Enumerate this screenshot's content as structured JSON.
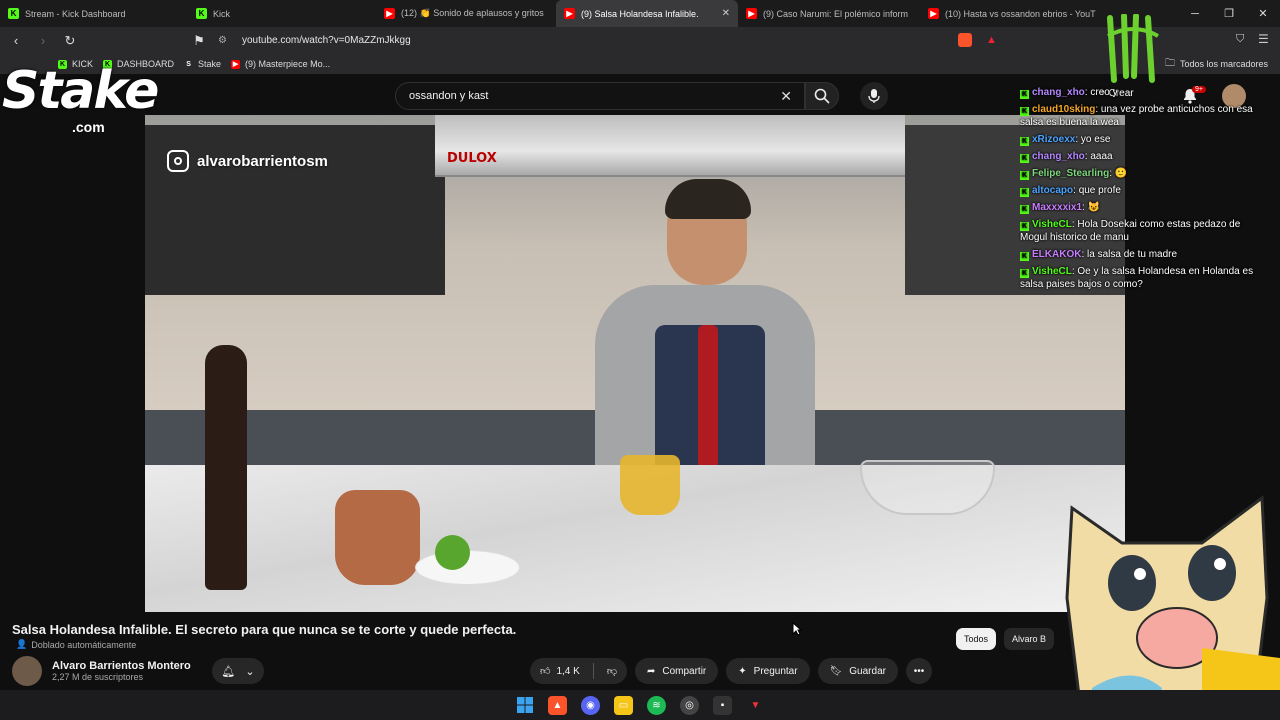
{
  "tabs": [
    {
      "label": "Stream - Kick Dashboard",
      "icon": "kick-icon",
      "active": false
    },
    {
      "label": "Kick",
      "icon": "kick-icon",
      "active": false
    },
    {
      "label": "(12) 👏 Sonido de aplausos y gritos",
      "icon": "youtube-icon",
      "active": false
    },
    {
      "label": "(9) Salsa Holandesa Infalible.",
      "icon": "youtube-icon",
      "active": true
    },
    {
      "label": "(9) Caso Narumi: El polémico inform",
      "icon": "youtube-icon",
      "active": false
    },
    {
      "label": "(10) Hasta vs ossandon ebrios - YouT",
      "icon": "youtube-icon",
      "active": false
    }
  ],
  "address": {
    "url": "youtube.com/watch?v=0MaZZmJkkgg"
  },
  "bookmarks": [
    {
      "label": "KICK",
      "icon": "kick-icon"
    },
    {
      "label": "DASHBOARD",
      "icon": "kick-icon"
    },
    {
      "label": "Stake",
      "icon": "stake-icon"
    },
    {
      "label": "(9) Masterpiece Mo...",
      "icon": "youtube-icon"
    }
  ],
  "bookmarks_folder": "Todos los marcadores",
  "search": {
    "value": "ossandon y kast"
  },
  "header": {
    "create_label": "Crear",
    "notifications_badge": "9+"
  },
  "video": {
    "watermark": "alvarobarrientosm",
    "hood_brand": "DULOX"
  },
  "overlay": {
    "stake_word": "Stake",
    "stake_suffix": ".com"
  },
  "chat": [
    {
      "user": "chang_xho",
      "color": "#b388ff",
      "text": "creo y"
    },
    {
      "user": "claud10sking",
      "color": "#f5a623",
      "text": "una vez probe anticuchos con esa salsa es buena la wea"
    },
    {
      "user": "xRizoexx",
      "color": "#4aa3ff",
      "text": "yo ese"
    },
    {
      "user": "chang_xho",
      "color": "#b388ff",
      "text": "aaaa"
    },
    {
      "user": "Felipe_Stearling",
      "color": "#7fd67f",
      "text": "🙂"
    },
    {
      "user": "altocapo",
      "color": "#4aa3ff",
      "text": "que profe"
    },
    {
      "user": "Maxxxxix1",
      "color": "#c77dff",
      "text": "😺"
    },
    {
      "user": "VisheCL",
      "color": "#53fc18",
      "text": "Hola Dosekai como estas pedazo de Mogul historico de manu"
    },
    {
      "user": "ELKAKOK",
      "color": "#c77dff",
      "text": "la salsa de tu madre"
    },
    {
      "user": "VisheCL",
      "color": "#53fc18",
      "text": "Oe y la salsa Holandesa en Holanda es salsa paises bajos o como?"
    }
  ],
  "meta": {
    "title": "Salsa Holandesa Infalible. El secreto para que nunca se te corte y quede perfecta.",
    "dubbed": "Doblado automáticamente",
    "channel": "Alvaro Barrientos Montero",
    "subscribers": "2,27 M de suscriptores",
    "likes": "1,4 K",
    "share": "Compartir",
    "ask": "Preguntar",
    "save": "Guardar"
  },
  "chips": [
    {
      "label": "Todos",
      "selected": true
    },
    {
      "label": "Alvaro B",
      "selected": false
    }
  ],
  "colors": {
    "kick": "#53fc18",
    "youtube": "#ff0000",
    "accent_red": "#cc0000"
  }
}
